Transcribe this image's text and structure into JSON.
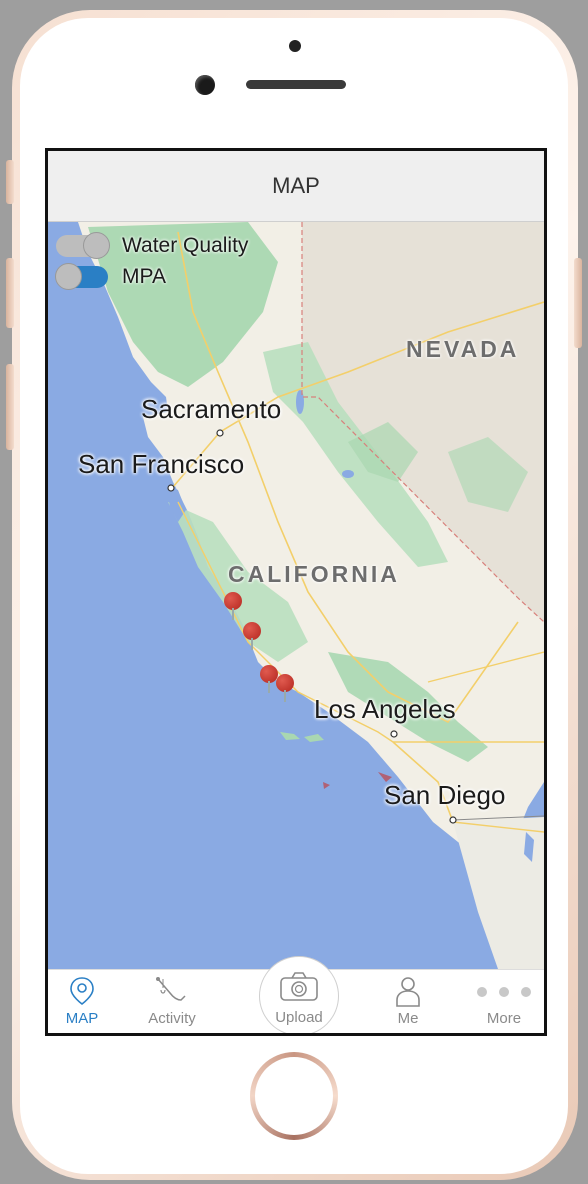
{
  "navbar": {
    "title": "MAP"
  },
  "layers": [
    {
      "label": "Water Quality",
      "enabled": false,
      "track_color": "#bdbdbd"
    },
    {
      "label": "MPA",
      "enabled": true,
      "track_color": "#2a7fc5"
    }
  ],
  "map": {
    "cities": [
      "Sacramento",
      "San Francisco",
      "Los Angeles",
      "San Diego"
    ],
    "states": [
      "NEVADA",
      "CALIFORNIA"
    ],
    "marker_count": 4,
    "colors": {
      "ocean": "#8aaae3",
      "land": "#f2efe6",
      "forest": "#a9d7b1",
      "nevada": "#e6e1d7",
      "marker": "#c9302c"
    }
  },
  "tabs": [
    {
      "label": "MAP",
      "icon": "map-pin-icon",
      "active": true
    },
    {
      "label": "Activity",
      "icon": "fishing-rod-icon",
      "active": false
    },
    {
      "label": "Upload",
      "icon": "camera-icon",
      "active": false
    },
    {
      "label": "Me",
      "icon": "person-icon",
      "active": false
    },
    {
      "label": "More",
      "icon": "more-dots-icon",
      "active": false
    }
  ],
  "accent_color": "#2a7fc5"
}
